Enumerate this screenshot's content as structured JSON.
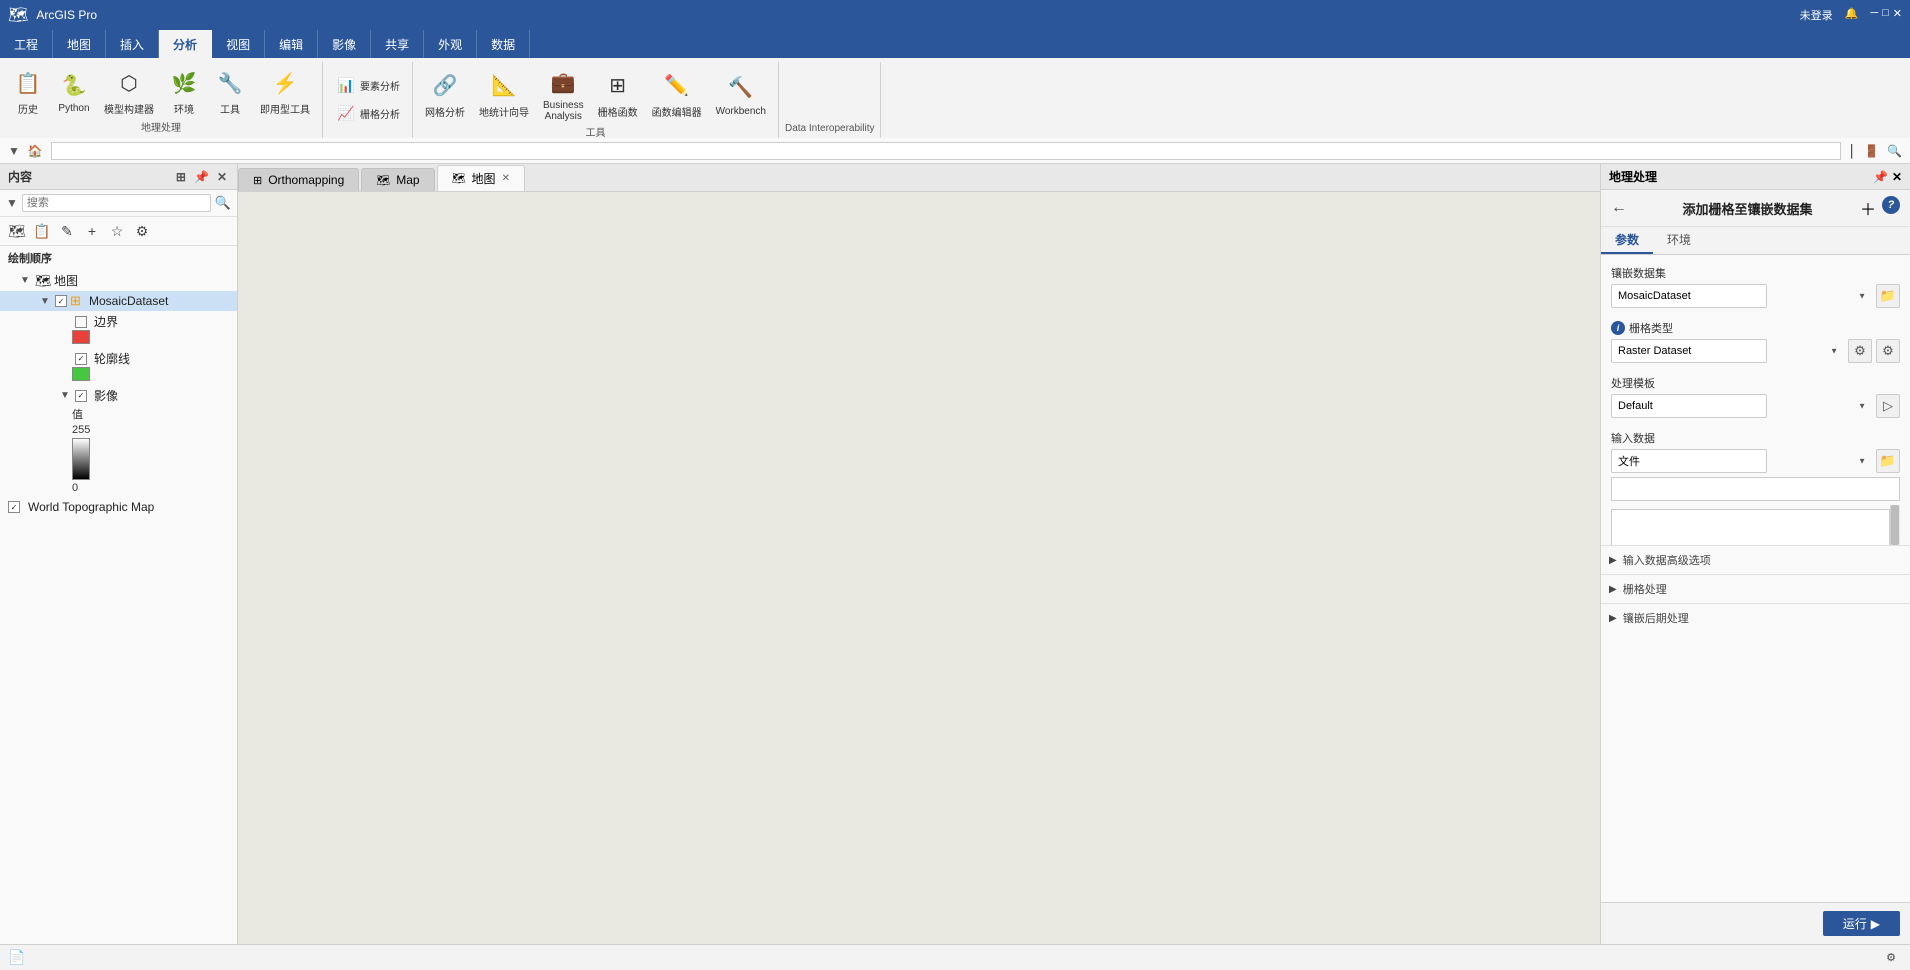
{
  "titlebar": {
    "app": "ArcGIS Pro",
    "login": "未登录",
    "window_controls": [
      "minimize",
      "maximize",
      "close"
    ]
  },
  "ribbon": {
    "tabs": [
      "工程",
      "地图",
      "插入",
      "分析",
      "视图",
      "编辑",
      "影像",
      "共享",
      "外观",
      "数据"
    ],
    "active_tab": "分析",
    "groups": [
      {
        "label": "地理处理",
        "buttons": [
          {
            "id": "history",
            "label": "历史",
            "icon": "📋"
          },
          {
            "id": "python",
            "label": "Python",
            "icon": "🐍"
          },
          {
            "id": "model-builder",
            "label": "模型构建器",
            "icon": "⬡"
          },
          {
            "id": "environment",
            "label": "环境",
            "icon": "🌿"
          },
          {
            "id": "tools",
            "label": "工具",
            "icon": "🔧"
          },
          {
            "id": "quick-tools",
            "label": "即用型工具",
            "icon": "⚡"
          }
        ]
      },
      {
        "label": "",
        "buttons": [
          {
            "id": "raster-analysis",
            "label": "要素分析",
            "icon": "📊"
          },
          {
            "id": "raster-stats",
            "label": "栅格分析",
            "icon": "📈"
          }
        ]
      },
      {
        "label": "工具",
        "buttons": [
          {
            "id": "network-analysis",
            "label": "网格分析",
            "icon": "🔗"
          },
          {
            "id": "spatial-guidance",
            "label": "地统计向导",
            "icon": "📐"
          },
          {
            "id": "business-analysis",
            "label": "Business Analysis",
            "icon": "💼"
          },
          {
            "id": "raster-functions",
            "label": "栅格函数",
            "icon": "⊞"
          },
          {
            "id": "raster-editor",
            "label": "函数编辑器",
            "icon": "✏️"
          },
          {
            "id": "workbench",
            "label": "Workbench",
            "icon": "🔨"
          }
        ]
      },
      {
        "label": "Data Interoperability",
        "buttons": []
      }
    ]
  },
  "address_bar": {
    "placeholder": ""
  },
  "left_panel": {
    "title": "内容",
    "search_placeholder": "搜索",
    "section_title": "绘制顺序",
    "layers": [
      {
        "id": "map-root",
        "name": "地图",
        "type": "map",
        "expanded": true,
        "children": [
          {
            "id": "mosaic-dataset",
            "name": "MosaicDataset",
            "type": "raster-group",
            "checked": true,
            "selected": true,
            "expanded": true,
            "children": [
              {
                "id": "boundary",
                "name": "边界",
                "type": "polygon",
                "checked": false,
                "color": "#e8413a"
              },
              {
                "id": "outline",
                "name": "轮廓线",
                "type": "polygon",
                "checked": true,
                "color": "#45c840"
              },
              {
                "id": "image",
                "name": "影像",
                "type": "raster",
                "checked": true,
                "has_legend": true,
                "legend_label": "值",
                "legend_max": "255",
                "legend_min": "0"
              }
            ]
          },
          {
            "id": "world-topo",
            "name": "World Topographic Map",
            "type": "web-map",
            "checked": true
          }
        ]
      }
    ]
  },
  "tabs": [
    {
      "id": "orthomapping",
      "label": "Orthomapping",
      "closeable": false,
      "active": false
    },
    {
      "id": "map-tab",
      "label": "Map",
      "closeable": false,
      "active": false
    },
    {
      "id": "ditu",
      "label": "地图",
      "closeable": true,
      "active": true
    }
  ],
  "right_panel": {
    "title": "地理处理",
    "tool_title": "添加栅格至镶嵌数据集",
    "param_tabs": [
      "参数",
      "环境"
    ],
    "active_param_tab": "参数",
    "params": {
      "mosaic_dataset": {
        "label": "镶嵌数据集",
        "value": "MosaicDataset",
        "required": false
      },
      "raster_type": {
        "label": "栅格类型",
        "value": "Raster Dataset",
        "required": true
      },
      "process_template": {
        "label": "处理模板",
        "value": "Default",
        "required": false
      },
      "input_data": {
        "label": "输入数据",
        "value": "文件",
        "required": false
      }
    },
    "sections": [
      {
        "id": "advanced-input",
        "label": "输入数据高级选项",
        "collapsed": true
      },
      {
        "id": "raster-processing",
        "label": "栅格处理",
        "collapsed": true
      },
      {
        "id": "mosaic-postprocess",
        "label": "镶嵌后期处理",
        "collapsed": true
      }
    ],
    "run_button": "运行"
  },
  "status_bar": {
    "icon": "📄"
  }
}
